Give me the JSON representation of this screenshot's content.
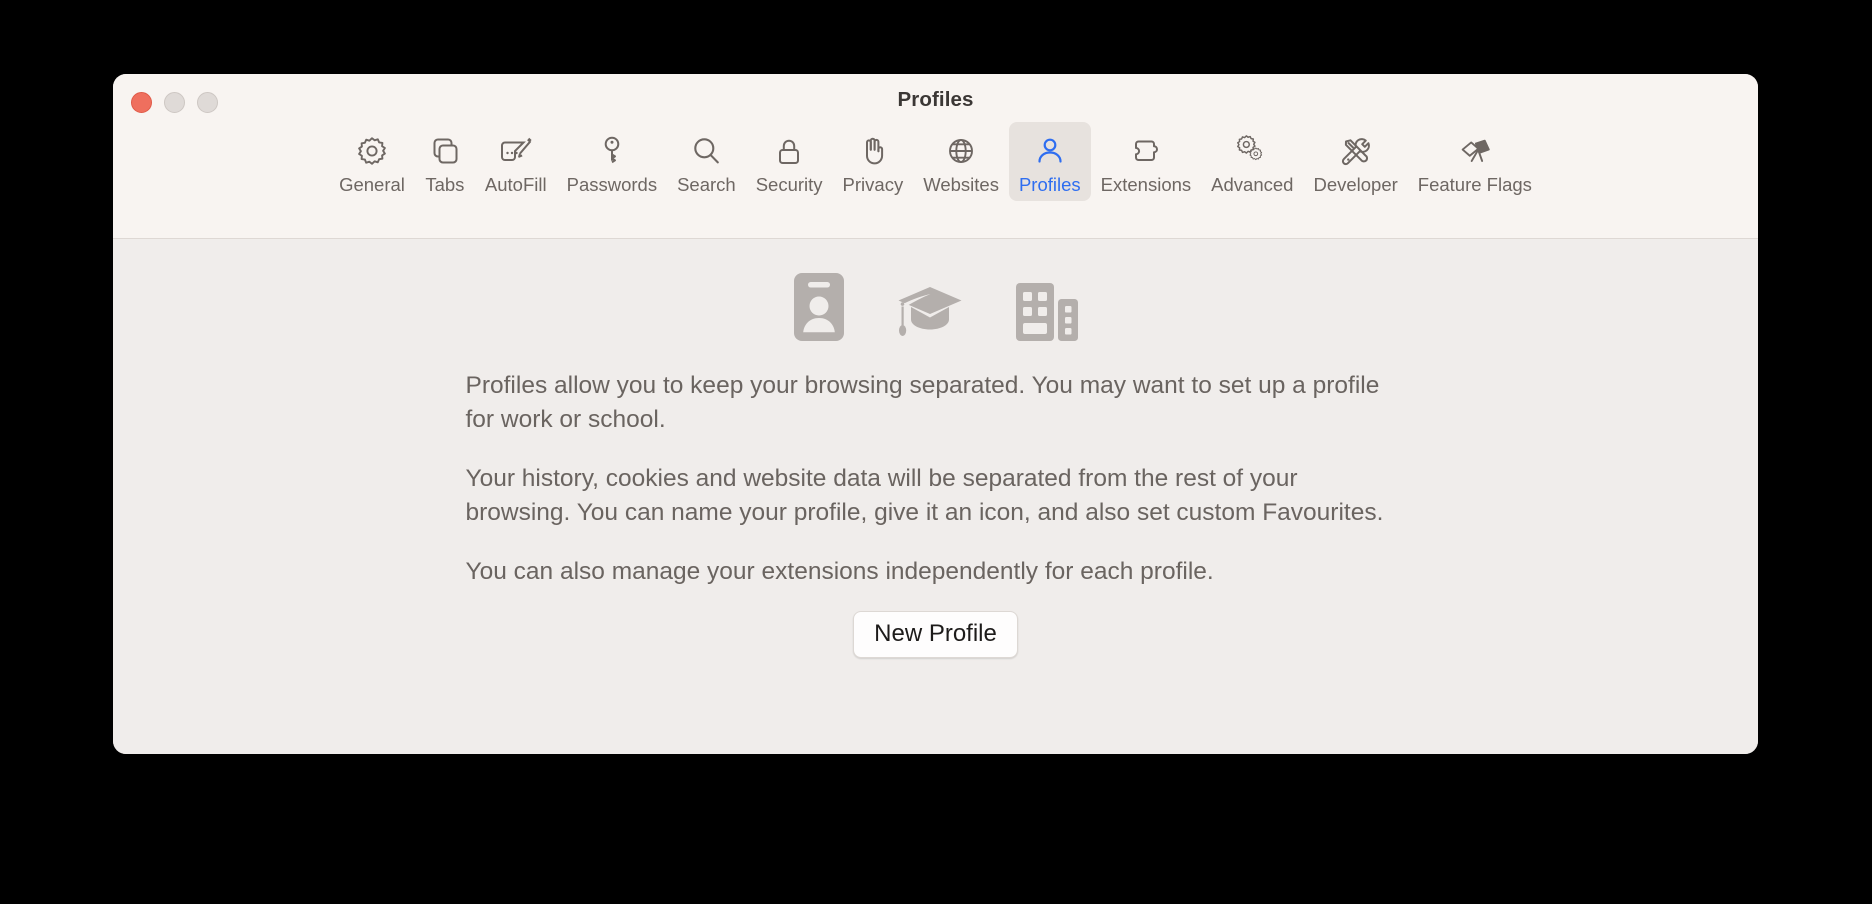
{
  "window": {
    "title": "Profiles",
    "traffic_lights": [
      {
        "name": "close",
        "color": "#ef6f5e"
      },
      {
        "name": "minimize",
        "color": "#dfdad7"
      },
      {
        "name": "maximize",
        "color": "#dfdad7"
      }
    ]
  },
  "toolbar": {
    "selected": "Profiles",
    "accent_color": "#2f6ef0",
    "tabs": [
      {
        "label": "General",
        "icon": "gear-icon"
      },
      {
        "label": "Tabs",
        "icon": "tabs-icon"
      },
      {
        "label": "AutoFill",
        "icon": "autofill-pencil-icon"
      },
      {
        "label": "Passwords",
        "icon": "key-icon"
      },
      {
        "label": "Search",
        "icon": "magnifier-icon"
      },
      {
        "label": "Security",
        "icon": "lock-icon"
      },
      {
        "label": "Privacy",
        "icon": "hand-icon"
      },
      {
        "label": "Websites",
        "icon": "globe-icon"
      },
      {
        "label": "Profiles",
        "icon": "person-icon"
      },
      {
        "label": "Extensions",
        "icon": "puzzle-piece-icon"
      },
      {
        "label": "Advanced",
        "icon": "double-gear-icon"
      },
      {
        "label": "Developer",
        "icon": "hammer-wrench-icon"
      },
      {
        "label": "Feature Flags",
        "icon": "flags-icon"
      }
    ]
  },
  "content": {
    "hero_icons": [
      {
        "name": "id-badge-icon"
      },
      {
        "name": "graduation-cap-icon"
      },
      {
        "name": "office-building-icon"
      }
    ],
    "paragraphs": [
      "Profiles allow you to keep your browsing separated. You may want to set up a profile for work or school.",
      "Your history, cookies and website data will be separated from the rest of your browsing. You can name your profile, give it an icon, and also set custom Favourites.",
      "You can also manage your extensions independently for each profile."
    ],
    "new_profile_button": "New Profile"
  }
}
